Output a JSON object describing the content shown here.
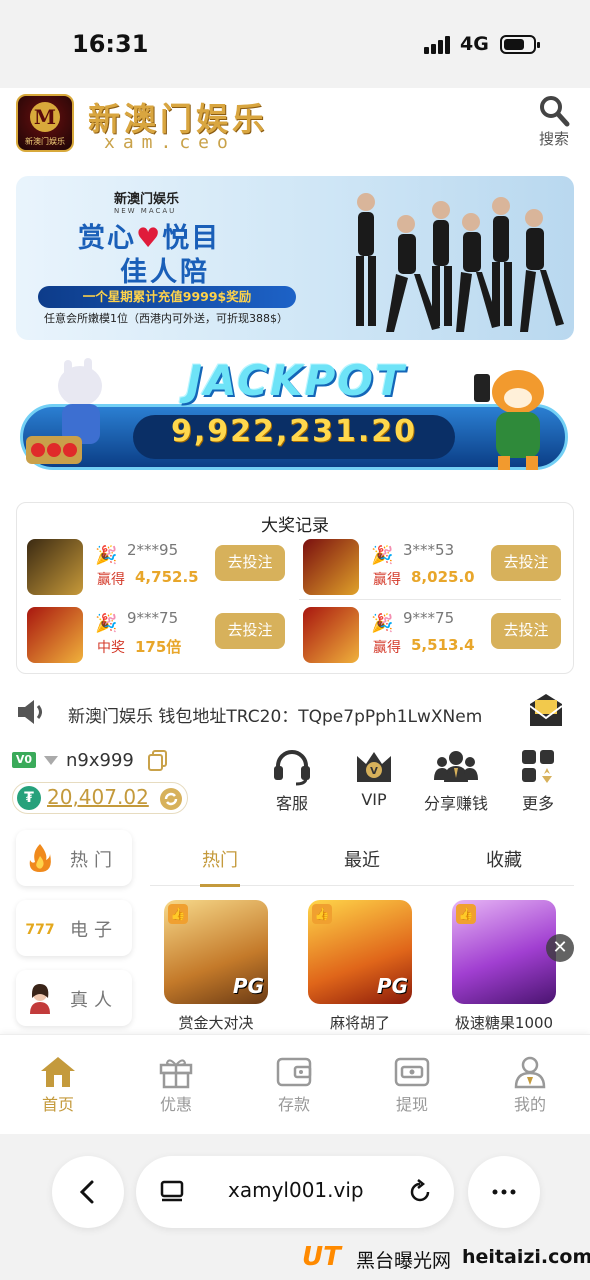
{
  "status_bar": {
    "time": "16:31",
    "network": "4G"
  },
  "header": {
    "brand_title": "新澳门娱乐",
    "brand_domain": "xam.ceo",
    "search_label": "搜索",
    "logo_text": "新澳门娱乐"
  },
  "banner": {
    "brand": "新澳门娱乐",
    "brand_en": "NEW MACAU",
    "line1_a": "赏心",
    "line1_heart": "♥",
    "line1_b": "悦目",
    "line2": "佳人陪",
    "promo": "一个星期累计充值9999$奖励",
    "note": "任意会所嫩模1位（西港内可外送，可折现388$）"
  },
  "jackpot": {
    "title": "JACKPOT",
    "amount": "9,922,231.20"
  },
  "winners": {
    "title": "大奖记录",
    "rows": [
      {
        "user": "2***95",
        "label": "赢得",
        "amount": "4,752.5",
        "button": "去投注"
      },
      {
        "user": "3***53",
        "label": "赢得",
        "amount": "8,025.0",
        "button": "去投注"
      },
      {
        "user": "9***75",
        "label": "中奖",
        "amount": "175倍",
        "button": "去投注"
      },
      {
        "user": "9***75",
        "label": "赢得",
        "amount": "5,513.4",
        "button": "去投注"
      }
    ]
  },
  "marquee": {
    "text": "新澳门娱乐  钱包地址TRC20：TQpe7pPph1LwXNem"
  },
  "account": {
    "vip_level": "V0",
    "username": "n9x999",
    "balance": "20,407.02",
    "currency_symbol": "₮"
  },
  "quick_actions": [
    {
      "label": "客服",
      "icon": "headset-icon"
    },
    {
      "label": "VIP",
      "icon": "vip-crown-icon"
    },
    {
      "label": "分享赚钱",
      "icon": "share-people-icon"
    },
    {
      "label": "更多",
      "icon": "grid-more-icon"
    }
  ],
  "categories": [
    {
      "label": "热门",
      "icon": "fire-icon"
    },
    {
      "label": "电子",
      "icon": "slot-777-icon"
    },
    {
      "label": "真人",
      "icon": "live-dealer-icon"
    }
  ],
  "tabs": [
    {
      "label": "热门",
      "active": true
    },
    {
      "label": "最近",
      "active": false
    },
    {
      "label": "收藏",
      "active": false
    }
  ],
  "games": [
    {
      "name": "赏金大对决",
      "tag": "PG"
    },
    {
      "name": "麻将胡了",
      "tag": "PG"
    },
    {
      "name": "极速糖果1000",
      "tag": ""
    }
  ],
  "bottom_nav": [
    {
      "label": "首页",
      "active": true
    },
    {
      "label": "优惠",
      "active": false
    },
    {
      "label": "存款",
      "active": false
    },
    {
      "label": "提现",
      "active": false
    },
    {
      "label": "我的",
      "active": false
    }
  ],
  "browser": {
    "url": "xamyl001.vip"
  },
  "watermark": {
    "brand": "UT",
    "site_cn": "黑台曝光网",
    "site": "heitaizi.com"
  },
  "colors": {
    "gold": "#c49a3c",
    "button_gold": "#d7b15b",
    "win_red": "#d43b2b",
    "amount_orange": "#e8a62a"
  }
}
